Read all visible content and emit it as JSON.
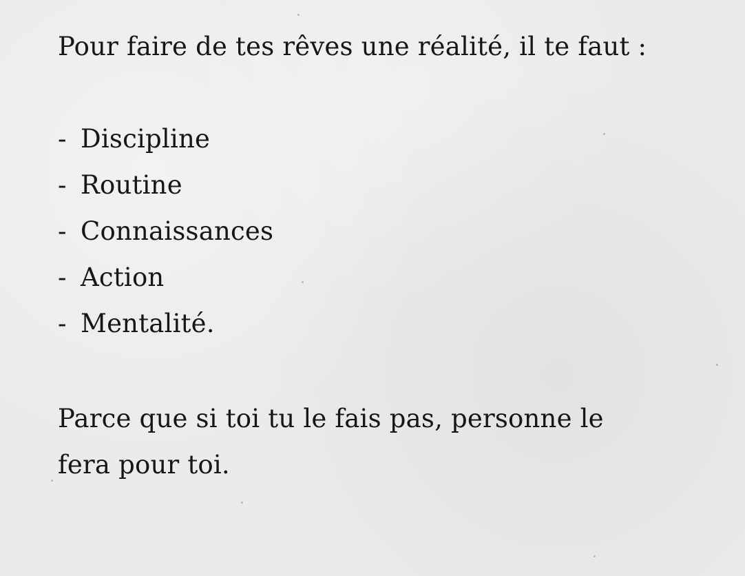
{
  "document": {
    "intro": "Pour faire de tes rêves une réalité, il te faut :",
    "items": [
      "Discipline",
      "Routine",
      "Connaissances",
      "Action",
      "Mentalité."
    ],
    "bullet_marker": "-",
    "closing_lines": [
      "Parce que si toi tu le fais pas, personne le",
      "fera pour toi."
    ]
  }
}
